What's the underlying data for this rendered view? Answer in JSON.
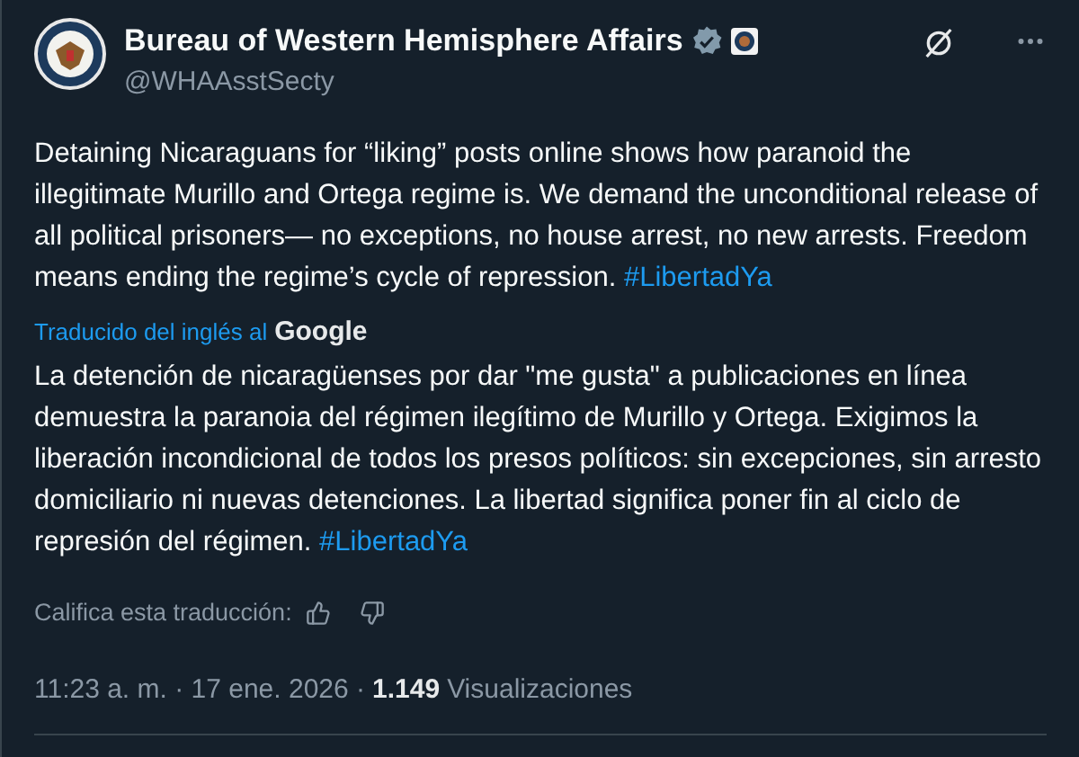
{
  "author": {
    "name": "Bureau of Western Hemisphere Affairs",
    "handle": "@WHAAsstSecty",
    "verified": true
  },
  "original": {
    "text": "Detaining Nicaraguans for “liking” posts online shows how paranoid the illegitimate Murillo and Ortega regime is. We demand the unconditional release of all political prisoners— no exceptions, no house arrest, no new arrests. Freedom means ending the regime’s cycle of repression.",
    "hashtag": "#LibertadYa"
  },
  "translation_note": {
    "label": "Traducido del inglés al",
    "provider": "Google"
  },
  "translation": {
    "text": "La detención de nicaragüenses por dar \"me gusta\" a publicaciones en línea demuestra la paranoia del régimen ilegítimo de Murillo y Ortega. Exigimos la liberación incondicional de todos los presos políticos: sin excepciones, sin arresto domiciliario ni nuevas detenciones. La libertad significa poner fin al ciclo de represión del régimen.",
    "hashtag": "#LibertadYa"
  },
  "rating": {
    "label": "Califica esta traducción:"
  },
  "meta": {
    "time": "11:23 a. m. · 17 ene. 2026 ·",
    "views_count": "1.149",
    "views_label": "Visualizaciones"
  }
}
